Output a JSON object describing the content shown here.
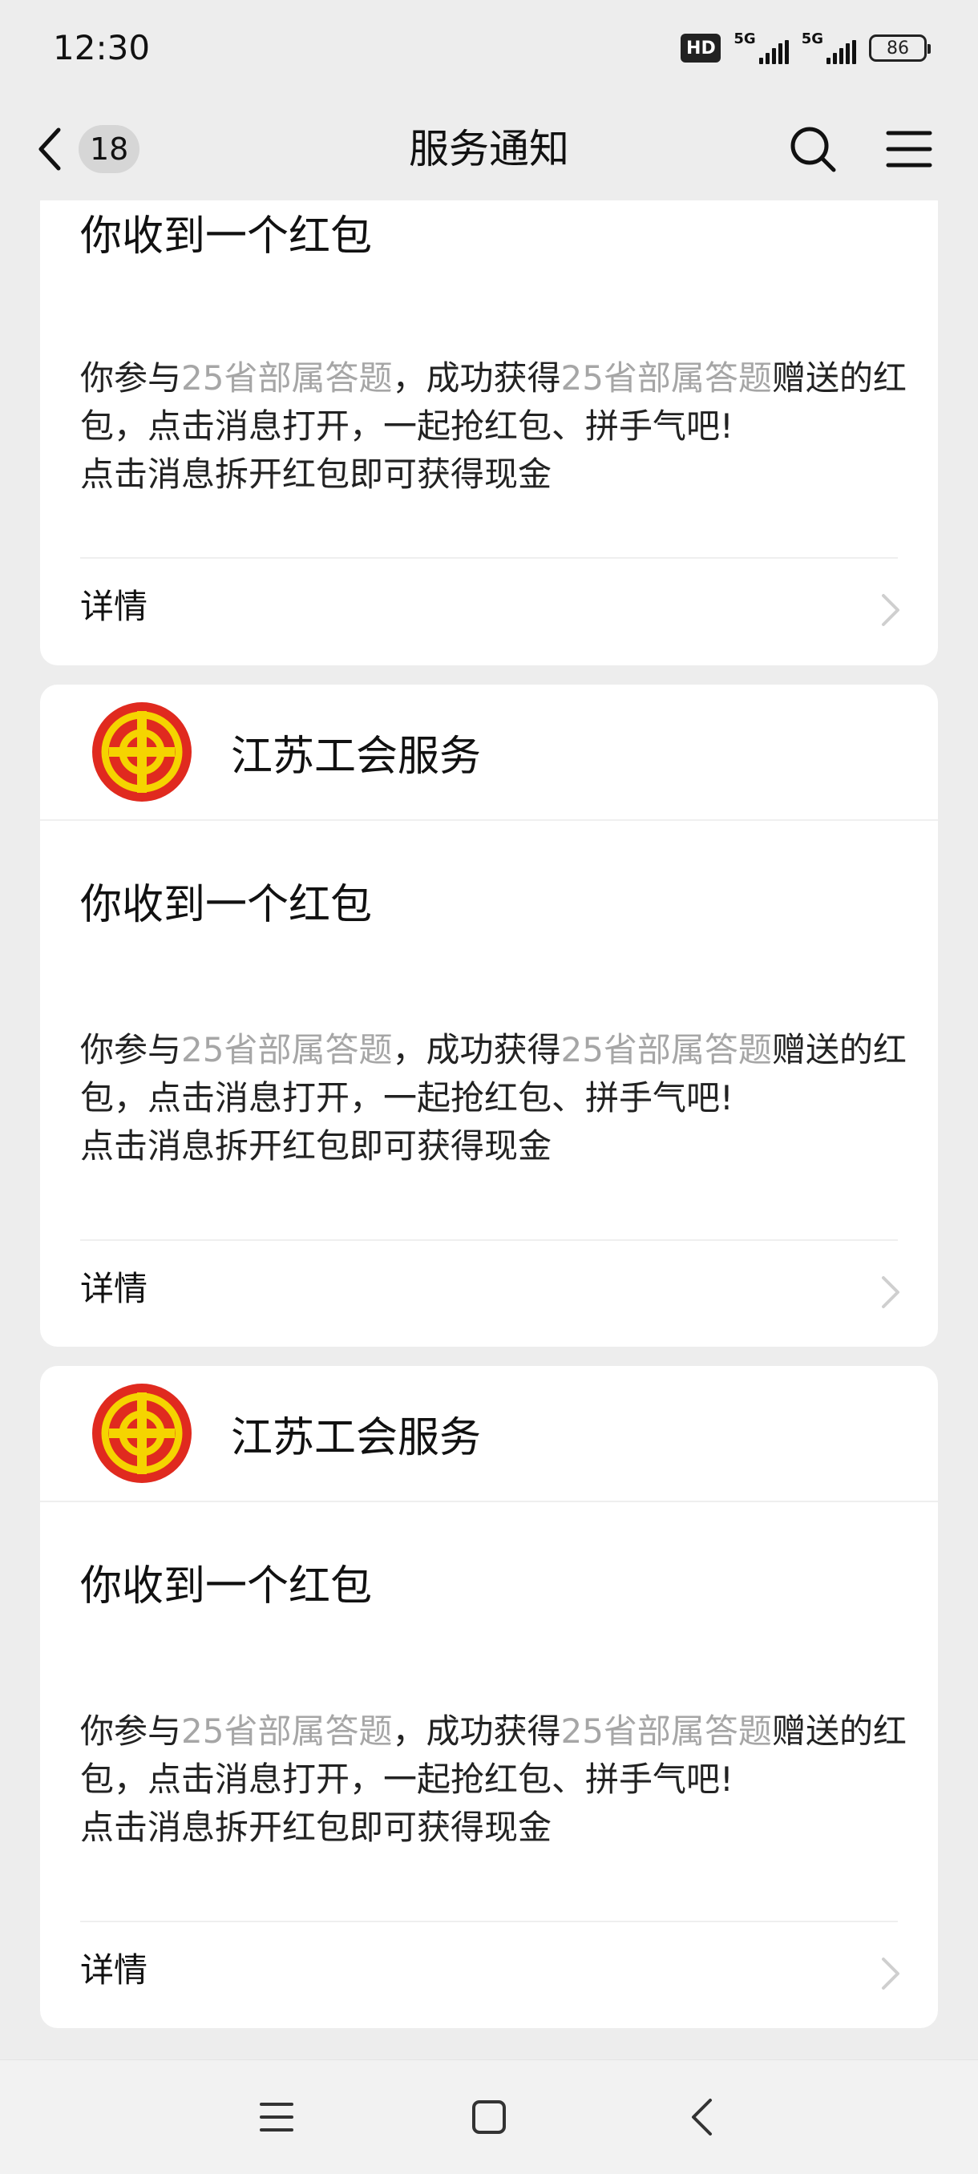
{
  "status_bar": {
    "time": "12:30",
    "hd": "HD",
    "network_1": "5G",
    "network_2": "5G",
    "battery": "86"
  },
  "header": {
    "title": "服务通知",
    "unread_count": "18"
  },
  "cards": [
    {
      "account": "",
      "title": "你收到一个红包",
      "body_prefix": "你参与",
      "body_hl_1": "25省部属答题",
      "body_mid": "，成功获得",
      "body_hl_2": "25省部属答题",
      "body_suffix": "赠送的红包，点击消息打开，一起抢红包、拼手气吧!",
      "body_line_2": "点击消息拆开红包即可获得现金",
      "details": "详情"
    },
    {
      "account": "江苏工会服务",
      "title": "你收到一个红包",
      "body_prefix": "你参与",
      "body_hl_1": "25省部属答题",
      "body_mid": "，成功获得",
      "body_hl_2": "25省部属答题",
      "body_suffix": "赠送的红包，点击消息打开，一起抢红包、拼手气吧!",
      "body_line_2": "点击消息拆开红包即可获得现金",
      "details": "详情"
    },
    {
      "account": "江苏工会服务",
      "title": "你收到一个红包",
      "body_prefix": "你参与",
      "body_hl_1": "25省部属答题",
      "body_mid": "，成功获得",
      "body_hl_2": "25省部属答题",
      "body_suffix": "赠送的红包，点击消息打开，一起抢红包、拼手气吧!",
      "body_line_2": "点击消息拆开红包即可获得现金",
      "details": "详情"
    }
  ],
  "icons": {
    "back": "chevron-left-icon",
    "search": "search-icon",
    "menu": "hamburger-menu-icon",
    "logo": "trade-union-logo-icon",
    "details": "chevron-right-icon",
    "sys_menu": "recent-apps-icon",
    "sys_home": "home-icon",
    "sys_back": "back-icon"
  },
  "colors": {
    "background": "#ededed",
    "card": "#ffffff",
    "highlight_text": "#a6a6a6",
    "logo_red": "#e02a1f",
    "logo_yellow": "#f5d400"
  }
}
